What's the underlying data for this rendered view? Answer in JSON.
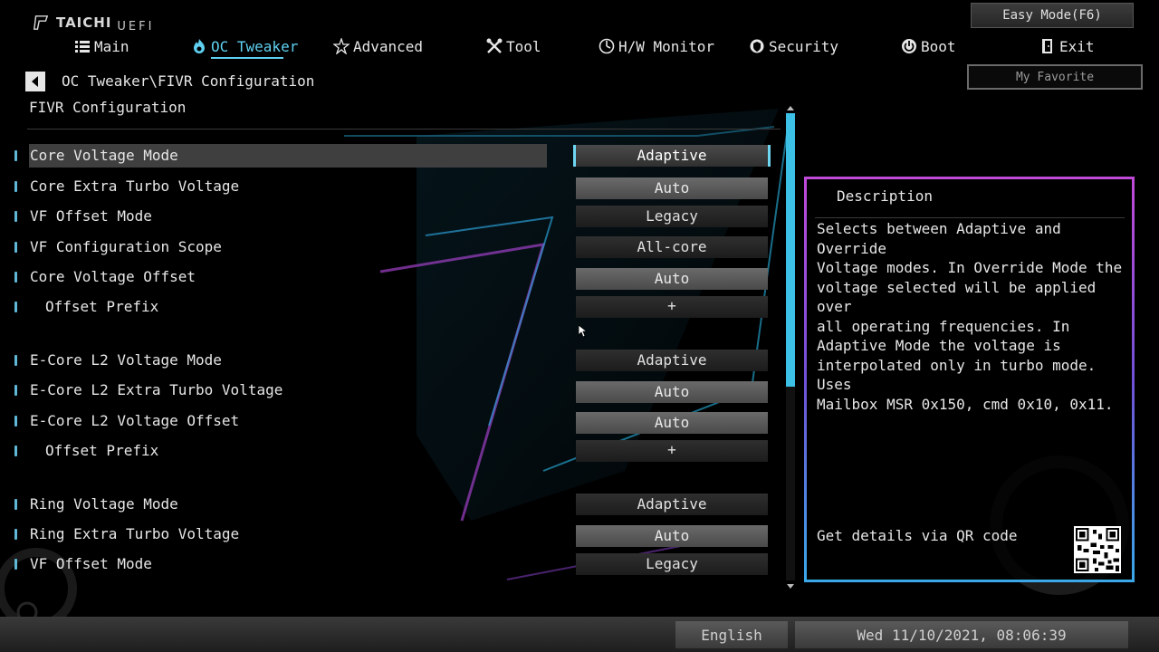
{
  "brand": {
    "logo": "TAICHI",
    "sub": "UEFI"
  },
  "easy_mode_label": "Easy Mode(F6)",
  "my_favorite_label": "My Favorite",
  "nav": [
    {
      "label": "Main",
      "icon": "list-icon"
    },
    {
      "label": "OC Tweaker",
      "icon": "flame-icon",
      "active": true
    },
    {
      "label": "Advanced",
      "icon": "star-icon"
    },
    {
      "label": "Tool",
      "icon": "tools-icon"
    },
    {
      "label": "H/W Monitor",
      "icon": "monitor-icon"
    },
    {
      "label": "Security",
      "icon": "shield-icon"
    },
    {
      "label": "Boot",
      "icon": "power-icon"
    },
    {
      "label": "Exit",
      "icon": "exit-icon"
    }
  ],
  "breadcrumb": "OC Tweaker\\FIVR Configuration",
  "page_title": "FIVR Configuration",
  "rows": [
    {
      "label": "Core Voltage Mode",
      "value": "Adaptive"
    },
    {
      "label": "Core Extra Turbo Voltage",
      "value": "Auto"
    },
    {
      "label": "VF Offset Mode",
      "value": "Legacy"
    },
    {
      "label": "VF Configuration Scope",
      "value": "All-core"
    },
    {
      "label": "Core Voltage Offset",
      "value": "Auto"
    },
    {
      "label": "Offset Prefix",
      "value": "+"
    },
    {
      "label": "E-Core L2 Voltage Mode",
      "value": "Adaptive"
    },
    {
      "label": "E-Core L2 Extra Turbo Voltage",
      "value": "Auto"
    },
    {
      "label": "E-Core L2 Voltage Offset",
      "value": "Auto"
    },
    {
      "label": "Offset Prefix",
      "value": "+"
    },
    {
      "label": "Ring Voltage Mode",
      "value": "Adaptive"
    },
    {
      "label": "Ring Extra Turbo Voltage",
      "value": "Auto"
    },
    {
      "label": "VF Offset Mode",
      "value": "Legacy"
    }
  ],
  "selected_row": "Core Voltage Mode",
  "description": {
    "title": "Description",
    "text": "Selects between Adaptive and Override\nVoltage modes. In Override Mode the\nvoltage selected will be applied over\nall operating frequencies. In\nAdaptive Mode the voltage is\ninterpolated only in turbo mode. Uses\nMailbox MSR 0x150, cmd 0x10, 0x11.",
    "qr_label": "Get details via QR code"
  },
  "footer": {
    "language": "English",
    "datetime": "Wed 11/10/2021, 08:06:39"
  },
  "colors": {
    "accent": "#5fd0f0",
    "scroll_thumb": "#3cc0e6",
    "desc_border_top": "#c04ad8",
    "desc_border_bottom": "#3aa8e8"
  }
}
